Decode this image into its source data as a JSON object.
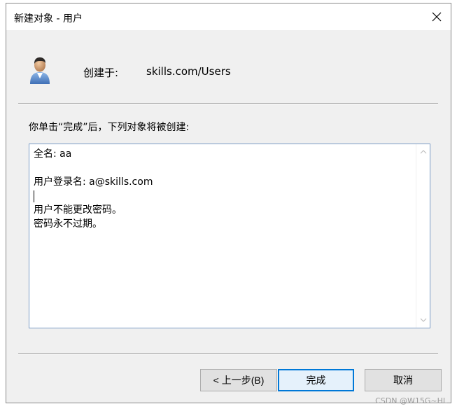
{
  "window": {
    "title": "新建对象 - 用户"
  },
  "header": {
    "create_in_label": "创建于:",
    "create_in_value": "skills.com/Users"
  },
  "info": {
    "text": "你单击“完成”后，下列对象将被创建:"
  },
  "summary": {
    "lines": [
      "全名: aa",
      "",
      "用户登录名: a@skills.com",
      "",
      "用户不能更改密码。",
      "密码永不过期。"
    ]
  },
  "buttons": {
    "back": "< 上一步(B)",
    "finish": "完成",
    "cancel": "取消"
  },
  "watermark": "CSDN @W15G~HL",
  "colors": {
    "accent": "#0078d7",
    "box_border": "#7a9cc6",
    "window_bg": "#f0f0f0"
  },
  "icons": {
    "close": "close-icon",
    "user": "user-icon",
    "scroll_up": "chevron-up-icon",
    "scroll_down": "chevron-down-icon"
  }
}
